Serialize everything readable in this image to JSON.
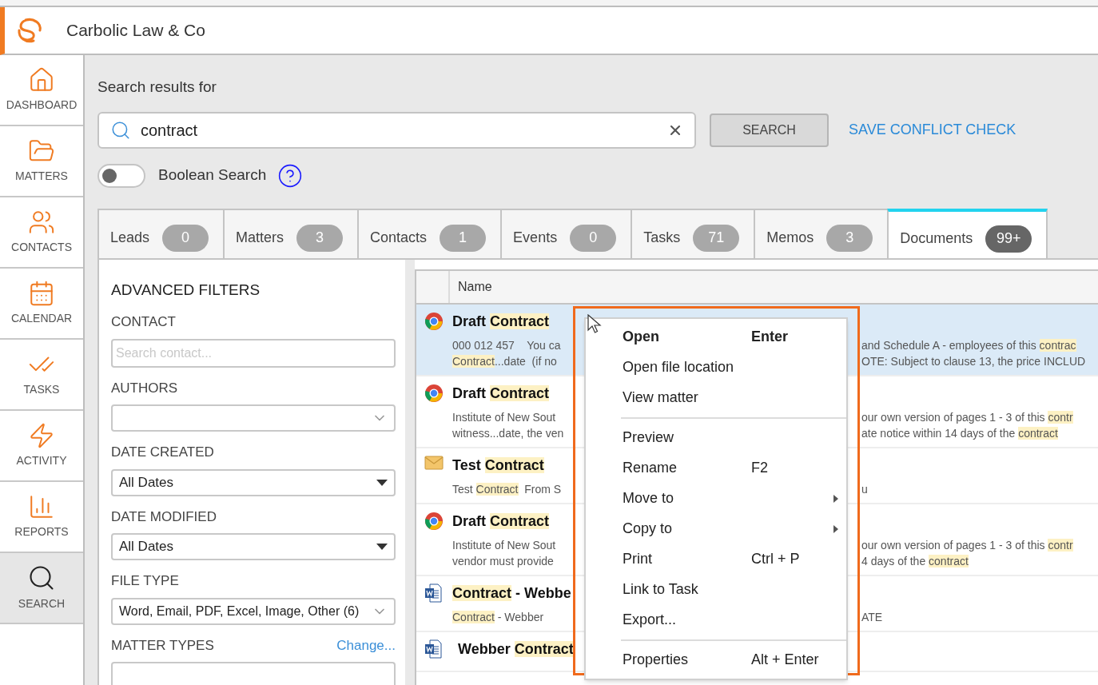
{
  "header": {
    "title": "Carbolic Law & Co"
  },
  "sidebar": {
    "items": [
      {
        "label": "DASHBOARD",
        "kind": "home",
        "selected": false
      },
      {
        "label": "MATTERS",
        "kind": "matters",
        "selected": false
      },
      {
        "label": "CONTACTS",
        "kind": "contacts",
        "selected": false
      },
      {
        "label": "CALENDAR",
        "kind": "calendar",
        "selected": false
      },
      {
        "label": "TASKS",
        "kind": "tasks",
        "selected": false
      },
      {
        "label": "ACTIVITY",
        "kind": "activity",
        "selected": false
      },
      {
        "label": "REPORTS",
        "kind": "reports",
        "selected": false
      },
      {
        "label": "SEARCH",
        "kind": "search",
        "selected": true
      }
    ]
  },
  "search": {
    "heading": "Search results for",
    "value": "contract",
    "button": "SEARCH",
    "link": "SAVE CONFLICT CHECK"
  },
  "boolean_search": {
    "label": "Boolean Search",
    "on": false
  },
  "tabs": [
    {
      "label": "Leads",
      "count": "0",
      "selected": false
    },
    {
      "label": "Matters",
      "count": "3",
      "selected": false
    },
    {
      "label": "Contacts",
      "count": "1",
      "selected": false
    },
    {
      "label": "Events",
      "count": "0",
      "selected": false
    },
    {
      "label": "Tasks",
      "count": "71",
      "selected": false
    },
    {
      "label": "Memos",
      "count": "3",
      "selected": false
    },
    {
      "label": "Documents",
      "count": "99+",
      "selected": true
    }
  ],
  "filters": {
    "title": "ADVANCED FILTERS",
    "fields": [
      {
        "kind": "text",
        "label": "CONTACT",
        "placeholder": "Search contact..."
      },
      {
        "kind": "combo",
        "label": "AUTHORS"
      },
      {
        "kind": "dropdown",
        "label": "DATE CREATED",
        "value": "All Dates"
      },
      {
        "kind": "dropdown",
        "label": "DATE MODIFIED",
        "value": "All Dates"
      },
      {
        "kind": "combo",
        "label": "FILE TYPE",
        "value": "Word, Email, PDF, Excel, Image, Other (6)"
      },
      {
        "kind": "combo",
        "label": "MATTER TYPES",
        "link": "Change..."
      }
    ]
  },
  "results": {
    "columns": [
      "Name"
    ],
    "rows": [
      {
        "kind": "web",
        "selected": true,
        "title": [
          {
            "text": "Draft ",
            "hl": false
          },
          {
            "text": "Contract",
            "hl": true
          }
        ],
        "lines": [
          {
            "left": [
              {
                "text": "000 012 457    You ca",
                "hl": false
              }
            ],
            "right": [
              {
                "text": "and Schedule A - employees of this ",
                "hl": false
              },
              {
                "text": "contrac",
                "hl": true
              }
            ]
          },
          {
            "left": [
              {
                "text": "Contract",
                "hl": true
              },
              {
                "text": "...date  (if no",
                "hl": false
              }
            ],
            "right": [
              {
                "text": "OTE: Subject to clause 13, the price INCLUD",
                "hl": false
              }
            ]
          }
        ]
      },
      {
        "kind": "web",
        "selected": false,
        "title": [
          {
            "text": "Draft ",
            "hl": false
          },
          {
            "text": "Contract",
            "hl": true
          }
        ],
        "lines": [
          {
            "left": [
              {
                "text": "Institute of New Sout",
                "hl": false
              }
            ],
            "right": [
              {
                "text": "our own version of pages 1 - 3 of this ",
                "hl": false
              },
              {
                "text": "contr",
                "hl": true
              }
            ]
          },
          {
            "left": [
              {
                "text": "witness...date, the ven",
                "hl": false
              }
            ],
            "right": [
              {
                "text": "ate notice within 14 days of the ",
                "hl": false
              },
              {
                "text": "contract",
                "hl": true
              }
            ]
          }
        ]
      },
      {
        "kind": "email",
        "selected": false,
        "title": [
          {
            "text": "Test ",
            "hl": false
          },
          {
            "text": "Contract",
            "hl": true
          }
        ],
        "lines": [
          {
            "left": [
              {
                "text": "Test ",
                "hl": false
              },
              {
                "text": "Contract",
                "hl": true
              },
              {
                "text": "  From S",
                "hl": false
              }
            ],
            "right": [
              {
                "text": "u",
                "hl": false
              }
            ]
          }
        ]
      },
      {
        "kind": "web",
        "selected": false,
        "title": [
          {
            "text": "Draft ",
            "hl": false
          },
          {
            "text": "Contract",
            "hl": true
          }
        ],
        "lines": [
          {
            "left": [
              {
                "text": "Institute of New Sout",
                "hl": false
              }
            ],
            "right": [
              {
                "text": "our own version of pages 1 - 3 of this ",
                "hl": false
              },
              {
                "text": "contr",
                "hl": true
              }
            ]
          },
          {
            "left": [
              {
                "text": "vendor must provide",
                "hl": false
              }
            ],
            "right": [
              {
                "text": "4 days of the ",
                "hl": false
              },
              {
                "text": "contract",
                "hl": true
              }
            ]
          }
        ]
      },
      {
        "kind": "word",
        "selected": false,
        "title": [
          {
            "text": "Contract",
            "hl": true
          },
          {
            "text": " - Webbe",
            "hl": false
          }
        ],
        "lines": [
          {
            "left": [
              {
                "text": "Contract",
                "hl": true
              },
              {
                "text": " - Webber",
                "hl": false
              }
            ],
            "right": [
              {
                "text": "ATE",
                "hl": false
              }
            ]
          }
        ]
      },
      {
        "kind": "word",
        "selected": false,
        "title": [
          {
            "text": "Webber ",
            "hl": false
          },
          {
            "text": "Contract",
            "hl": true
          }
        ],
        "lines": []
      }
    ]
  },
  "context_menu": {
    "items": [
      {
        "kind": "item",
        "label": "Open",
        "shortcut": "Enter",
        "bold": true,
        "submenu": false
      },
      {
        "kind": "item",
        "label": "Open file location",
        "bold": false,
        "submenu": false
      },
      {
        "kind": "item",
        "label": "View matter",
        "bold": false,
        "submenu": false
      },
      {
        "kind": "separator"
      },
      {
        "kind": "item",
        "label": "Preview",
        "bold": false,
        "submenu": false
      },
      {
        "kind": "item",
        "label": "Rename",
        "shortcut": "F2",
        "bold": false,
        "submenu": false
      },
      {
        "kind": "item",
        "label": "Move to",
        "bold": false,
        "submenu": true
      },
      {
        "kind": "item",
        "label": "Copy to",
        "bold": false,
        "submenu": true
      },
      {
        "kind": "item",
        "label": "Print",
        "shortcut": "Ctrl + P",
        "bold": false,
        "submenu": false
      },
      {
        "kind": "item",
        "label": "Link to Task",
        "bold": false,
        "submenu": false
      },
      {
        "kind": "item",
        "label": "Export...",
        "bold": false,
        "submenu": false
      },
      {
        "kind": "separator"
      },
      {
        "kind": "item",
        "label": "Properties",
        "shortcut": "Alt + Enter",
        "bold": false,
        "submenu": false
      }
    ]
  }
}
